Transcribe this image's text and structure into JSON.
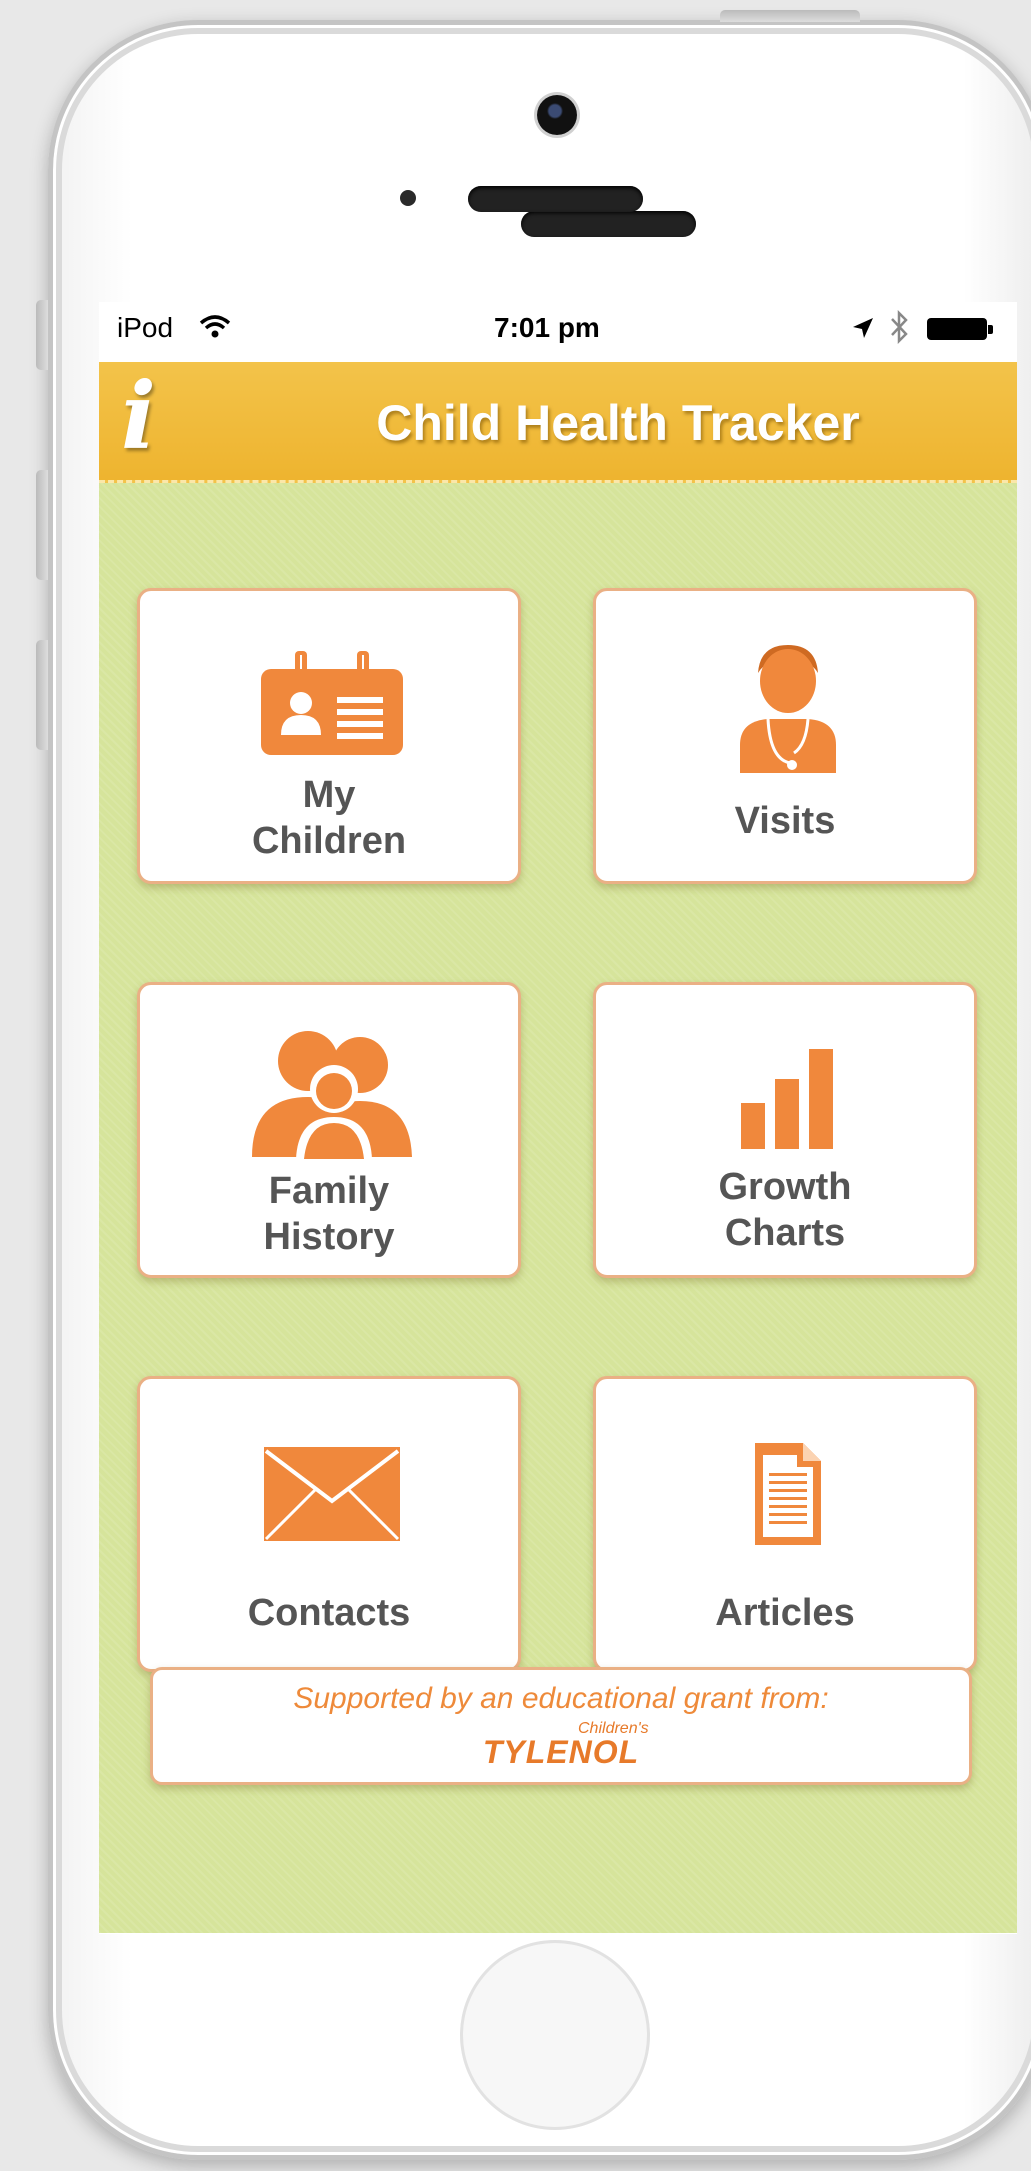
{
  "status_bar": {
    "carrier": "iPod",
    "time": "7:01 pm"
  },
  "header": {
    "info_glyph": "i",
    "title": "Child Health Tracker"
  },
  "tiles": [
    {
      "label_line1": "My",
      "label_line2": "Children",
      "icon": "id-card-icon"
    },
    {
      "label_line1": "Visits",
      "label_line2": "",
      "icon": "doctor-icon"
    },
    {
      "label_line1": "Family",
      "label_line2": "History",
      "icon": "family-icon"
    },
    {
      "label_line1": "Growth",
      "label_line2": "Charts",
      "icon": "bar-chart-icon"
    },
    {
      "label_line1": "Contacts",
      "label_line2": "",
      "icon": "envelope-icon"
    },
    {
      "label_line1": "Articles",
      "label_line2": "",
      "icon": "document-icon"
    }
  ],
  "sponsor": {
    "text": "Supported by an educational grant from:",
    "brand_small": "Children's",
    "brand": "TYLENOL"
  },
  "colors": {
    "header": "#eeb42f",
    "background": "#d6e49b",
    "accent": "#f0883c",
    "label": "#555555"
  }
}
